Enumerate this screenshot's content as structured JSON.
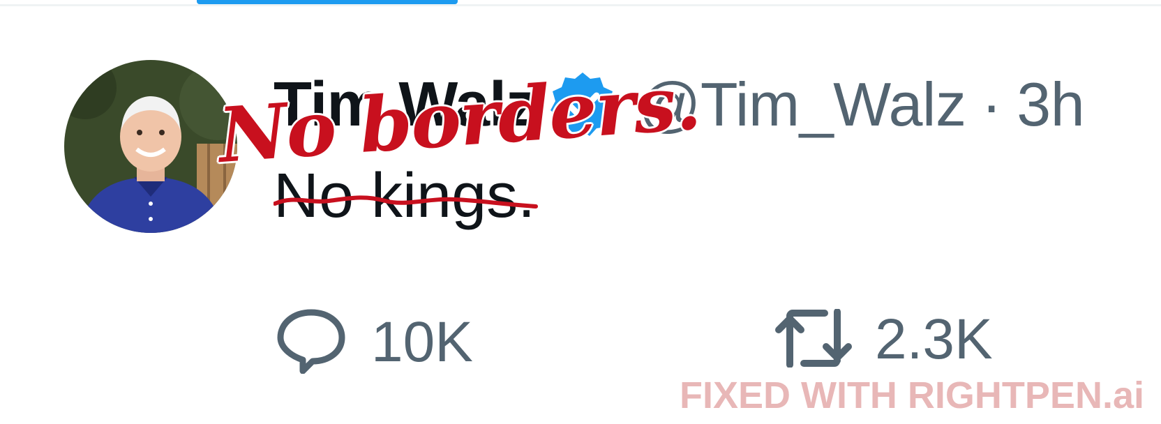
{
  "tweet": {
    "display_name": "Tim Walz",
    "verified_icon": "verified-badge-icon",
    "handle": "@Tim_Walz",
    "separator": "·",
    "time": "3h",
    "text": "No kings.",
    "text_struck_through": true
  },
  "annotation": {
    "handwritten_text": "No borders.",
    "color": "#c8101e"
  },
  "actions": {
    "reply": {
      "icon": "reply-icon",
      "count": "10K"
    },
    "retweet": {
      "icon": "retweet-icon",
      "count": "2.3K"
    }
  },
  "watermark": {
    "text": "FIXED WITH RIGHTPEN.ai"
  },
  "colors": {
    "accent": "#1d9bf0",
    "text_primary": "#0f1419",
    "text_secondary": "#536471",
    "watermark": "#e8b7b7"
  }
}
